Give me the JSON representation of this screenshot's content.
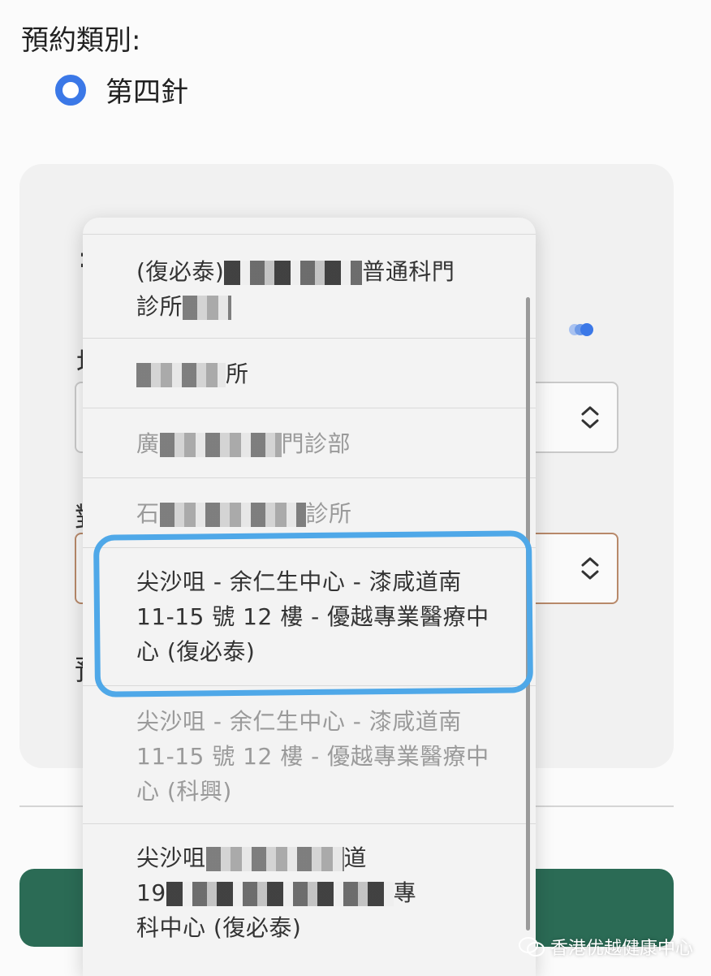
{
  "header": {
    "label": "預約類別:"
  },
  "category": {
    "selected_label": "第四針"
  },
  "dropdown": {
    "options": [
      {
        "line1": "(復必泰)",
        "line1_tail": "普通科門",
        "line2": "診所"
      },
      {
        "line1": "所"
      },
      {
        "line1_head": "廣",
        "line1_tail": "門診部"
      },
      {
        "line1_head": "石",
        "line1_tail": "診所"
      },
      {
        "line1": "尖沙咀 - 余仁生中心 - 漆咸道南",
        "line2": "11-15 號 12 樓 - 優越專業醫療中",
        "line3": "心 (復必泰)"
      },
      {
        "line1": "尖沙咀 - 余仁生中心 - 漆咸道南",
        "line2": "11-15 號 12 樓 - 優越專業醫療中",
        "line3": "心 (科興)"
      },
      {
        "line1": "尖沙咀",
        "line1_tail": "道",
        "line2": "19",
        "line2_tail": "專",
        "line3": "科中心 (復必泰)"
      }
    ]
  },
  "watermark": {
    "text": "香港优越健康中心",
    "icon": "wechat-icon"
  },
  "colors": {
    "accent": "#3b78e7",
    "highlight": "#4fa8e8",
    "button": "#2b6b55"
  }
}
